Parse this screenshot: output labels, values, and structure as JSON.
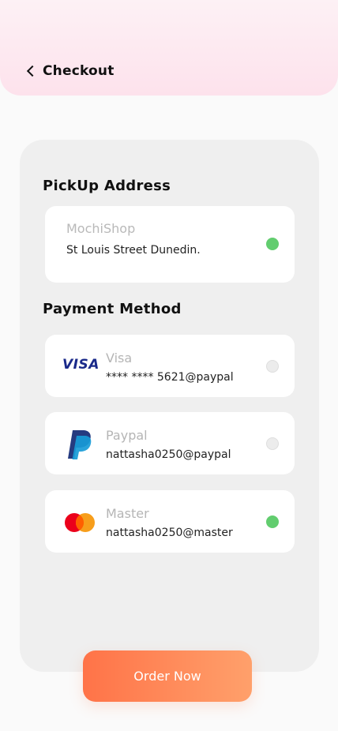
{
  "header": {
    "back_label": "Checkout"
  },
  "pickup": {
    "section_title": "PickUp Address",
    "shop_name": "MochiShop",
    "address": "St Louis Street Dunedin.",
    "selected": true
  },
  "payment": {
    "section_title": "Payment Method",
    "methods": [
      {
        "logo_text": "VISA",
        "name": "Visa",
        "account": "**** **** 5621@paypal",
        "icon": "visa-logo-icon",
        "selected": false
      },
      {
        "name": "Paypal",
        "account": "nattasha0250@paypal",
        "icon": "paypal-logo-icon",
        "selected": false
      },
      {
        "name": "Master",
        "account": "nattasha0250@master",
        "icon": "mastercard-logo-icon",
        "selected": true
      }
    ]
  },
  "order_button": "Order Now",
  "colors": {
    "accent_start": "#ff7348",
    "accent_end": "#ffa06b",
    "selected_dot": "#62cd6f",
    "header_bg": "#fde2ec"
  }
}
